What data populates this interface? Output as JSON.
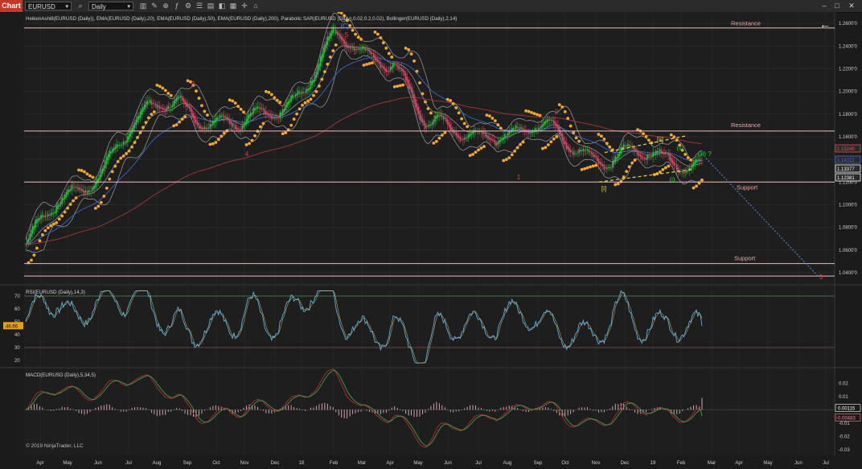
{
  "toolbar": {
    "app_tab": "Chart",
    "instrument": "EURUSD",
    "period": "Daily",
    "icons": [
      "search-icon",
      "bar-style-icon",
      "drawing-tools-icon",
      "zoom-icon",
      "indicator-icon",
      "strategy-icon",
      "properties-icon",
      "data-box-icon",
      "chart-trader-icon",
      "templates-icon",
      "crosshair-icon",
      "lock-icon",
      "template-icon"
    ],
    "window_controls": [
      "minimize-icon",
      "maximize-icon",
      "close-icon"
    ]
  },
  "price_panel": {
    "header": "HeikenAshi8(EURUSD (Daily)), EMA(EURUSD (Daily),20), EMA(EURUSD (Daily),50), EMA(EURUSD (Daily),200), Parabolic SAR(EURUSD (Daily),0.02,0.2,0.02), Bollinger(EURUSD (Daily),2,14)",
    "back_arrow": "←",
    "y_ticks": [
      "1.2600'0",
      "1.2400'0",
      "1.2200'0",
      "1.2000'0",
      "1.1800'0",
      "1.1600'0",
      "1.1400'0",
      "1.1200'0",
      "1.1000'0",
      "1.0800'0",
      "1.0600'0",
      "1.0400'0"
    ],
    "price_tags": [
      {
        "text": "1.15249",
        "color": "#e0505a"
      },
      {
        "text": "1.14222",
        "color": "#3a6fd8"
      },
      {
        "text": "1.13377",
        "color": "#ffffff"
      },
      {
        "text": "1.12381",
        "color": "#ffffff"
      }
    ],
    "level_labels": [
      "Resistance",
      "Resistance",
      "Support",
      "Support"
    ],
    "wave_labels": [
      {
        "text": "(C)",
        "color": "#4a90d9"
      },
      {
        "text": "5",
        "color": "#e0404a"
      },
      {
        "text": "3",
        "color": "#e0404a"
      },
      {
        "text": "4",
        "color": "#e0404a"
      },
      {
        "text": "2",
        "color": "#e0404a"
      },
      {
        "text": "1",
        "color": "#e0404a"
      },
      {
        "text": "3",
        "color": "#e0404a"
      },
      {
        "text": "[ii]",
        "color": "#e8d44d"
      },
      {
        "text": "[i]",
        "color": "#e8d44d"
      },
      {
        "text": "(ii)",
        "color": "#2ecc40"
      },
      {
        "text": "(i)",
        "color": "#2ecc40"
      },
      {
        "text": "(iii) ?",
        "color": "#2ecc40"
      }
    ]
  },
  "rsi_panel": {
    "header": "RSI(EURUSD (Daily),14,3)",
    "y_ticks": [
      "70",
      "60",
      "50",
      "40",
      "30",
      "20"
    ],
    "value_tag": "46.66",
    "value_tag_color": "#e0a020"
  },
  "macd_panel": {
    "header": "MACD(EURUSD (Daily),5,34,5)",
    "y_ticks": [
      "0.02",
      "0.01",
      "0",
      "-0.01",
      "-0.02",
      "-0.03"
    ],
    "value_tags": [
      {
        "text": "0.00115",
        "color": "#ffffff"
      },
      {
        "text": "-0.00483",
        "color": "#ff7f8a"
      }
    ],
    "copyright": "© 2019 NinjaTrader, LLC"
  },
  "x_axis": {
    "labels": [
      "Apr",
      "May",
      "Jun",
      "Jul",
      "Aug",
      "Sep",
      "Oct",
      "Nov",
      "Dec",
      "18",
      "Feb",
      "Mar",
      "Apr",
      "May",
      "Jun",
      "Jul",
      "Aug",
      "Sep",
      "Oct",
      "Nov",
      "Dec",
      "19",
      "Feb",
      "Mar",
      "Apr",
      "May",
      "Jun",
      "Jul"
    ]
  },
  "colors": {
    "background": "#1b1b1b",
    "bull_candle": "#35c04a",
    "bear_candle": "#d0506a",
    "level_line": "#f2b8b8",
    "sar_dots": "#f0a830",
    "ema20": "#9a9a9a",
    "ema50": "#3a6fd8",
    "ema200": "#a03a3a",
    "bollinger": "#cfcfcf",
    "rsi_line": "#5ab0e0",
    "macd_line": "#b03030",
    "signal_line": "#4a9a4a"
  },
  "chart_data": {
    "type": "candlestick",
    "instrument": "EURUSD",
    "timeframe": "Daily",
    "x": [
      "Apr",
      "May",
      "Jun",
      "Jul",
      "Aug",
      "Sep",
      "Oct",
      "Nov",
      "Dec",
      "18",
      "Feb",
      "Mar",
      "Apr",
      "May",
      "Jun",
      "Jul",
      "Aug",
      "Sep",
      "Oct",
      "Nov",
      "Dec",
      "19",
      "Feb"
    ],
    "close": [
      1.065,
      1.095,
      1.122,
      1.155,
      1.178,
      1.195,
      1.175,
      1.165,
      1.183,
      1.205,
      1.243,
      1.233,
      1.232,
      1.166,
      1.163,
      1.169,
      1.158,
      1.167,
      1.155,
      1.135,
      1.142,
      1.147,
      1.133
    ],
    "ylim": [
      1.03,
      1.27
    ],
    "horizontal_levels": [
      {
        "label": "Resistance",
        "value": 1.256
      },
      {
        "label": "Resistance",
        "value": 1.165
      },
      {
        "label": "Support",
        "value": 1.12
      },
      {
        "label": "Support",
        "value": 1.048
      }
    ],
    "extra_level": 1.037,
    "projection": {
      "from": [
        1.141,
        "Feb"
      ],
      "to": [
        1.037,
        "Jul"
      ]
    },
    "rsi": {
      "ylim": [
        15,
        75
      ],
      "levels": [
        70,
        30
      ],
      "last": 46.66
    },
    "macd": {
      "ylim": [
        -0.035,
        0.027
      ],
      "macd": 0.00115,
      "signal": -0.00483
    }
  }
}
